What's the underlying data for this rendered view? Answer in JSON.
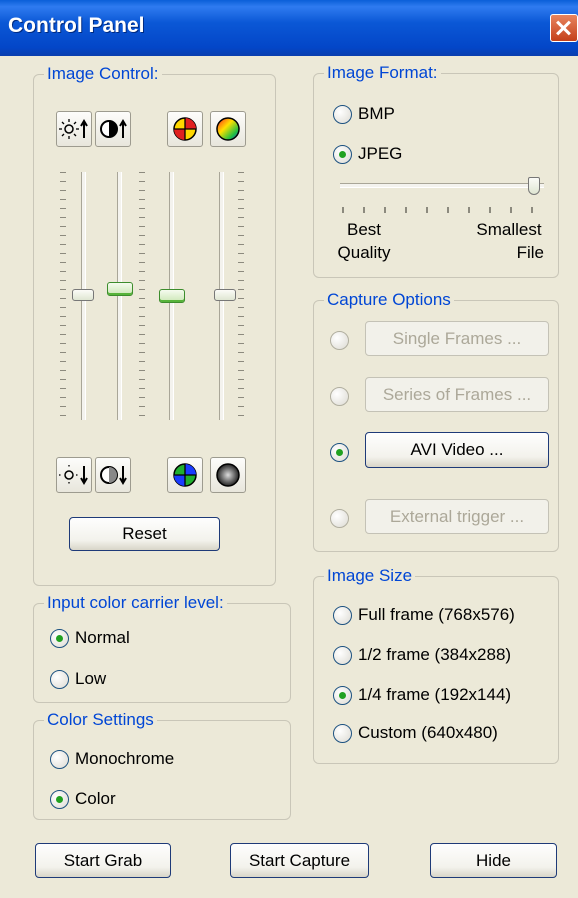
{
  "window": {
    "title": "Control Panel"
  },
  "image_control": {
    "legend": "Image Control:",
    "top_icons": [
      "brightness-up-icon",
      "contrast-up-icon",
      "hue-icon",
      "saturation-up-icon"
    ],
    "bottom_icons": [
      "brightness-down-icon",
      "contrast-down-icon",
      "hue-down-icon",
      "saturation-down-icon"
    ],
    "reset_label": "Reset"
  },
  "image_format": {
    "legend": "Image Format:",
    "options": [
      "BMP",
      "JPEG"
    ],
    "selected": "JPEG",
    "quality_slider_value": 1.0,
    "label_left_line1": "Best",
    "label_left_line2": "Quality",
    "label_right_line1": "Smallest",
    "label_right_line2": "File"
  },
  "capture_options": {
    "legend": "Capture Options",
    "single_frames": "Single Frames ...",
    "series_frames": "Series of Frames ...",
    "avi_video": "AVI Video ...",
    "external_trigger": "External trigger ...",
    "selected": "AVI Video ..."
  },
  "color_carrier": {
    "legend": "Input color carrier level:",
    "normal": "Normal",
    "low": "Low",
    "selected": "Normal"
  },
  "color_settings": {
    "legend": "Color Settings",
    "monochrome": "Monochrome",
    "color": "Color",
    "selected": "Color"
  },
  "image_size": {
    "legend": "Image Size",
    "full": "Full frame (768x576)",
    "half": "1/2 frame (384x288)",
    "quarter": "1/4 frame (192x144)",
    "custom": "Custom (640x480)",
    "selected": "1/4 frame (192x144)"
  },
  "footer": {
    "start_grab": "Start Grab",
    "start_capture": "Start Capture",
    "hide": "Hide"
  },
  "colors": {
    "title_bar": "#0a58d6",
    "legend_text": "#0046d5",
    "dialog_bg": "#ece9d8"
  }
}
